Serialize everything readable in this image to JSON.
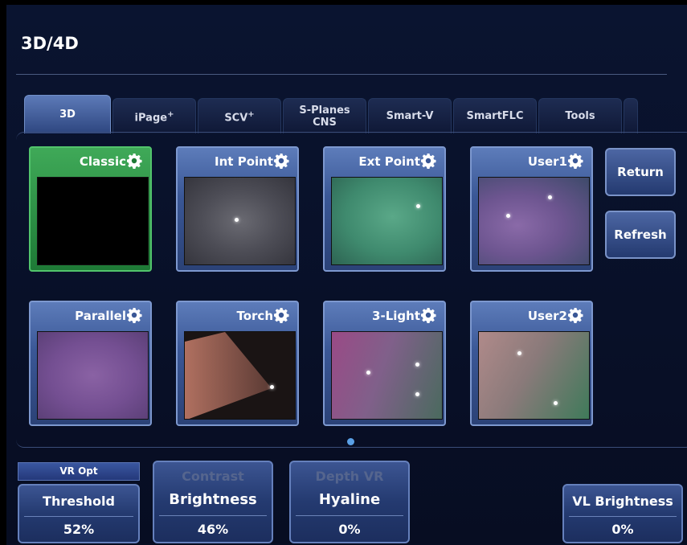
{
  "header": {
    "title": "3D/4D"
  },
  "tabs": [
    {
      "label": "3D",
      "sup": "",
      "active": true
    },
    {
      "label": "iPage",
      "sup": "+",
      "active": false
    },
    {
      "label": "SCV",
      "sup": "+",
      "active": false
    },
    {
      "label": "S-Planes\nCNS",
      "sup": "",
      "active": false
    },
    {
      "label": "Smart-V",
      "sup": "",
      "active": false
    },
    {
      "label": "SmartFLC",
      "sup": "",
      "active": false
    },
    {
      "label": "Tools",
      "sup": "",
      "active": false
    }
  ],
  "presets": [
    {
      "label": "Classic",
      "selected": true
    },
    {
      "label": "Int Point",
      "selected": false
    },
    {
      "label": "Ext Point",
      "selected": false
    },
    {
      "label": "User1",
      "selected": false
    },
    {
      "label": "Parallel",
      "selected": false
    },
    {
      "label": "Torch",
      "selected": false
    },
    {
      "label": "3-Light",
      "selected": false
    },
    {
      "label": "User2",
      "selected": false
    }
  ],
  "side_buttons": {
    "return_label": "Return",
    "refresh_label": "Refresh"
  },
  "controls": {
    "vr_opt_label": "VR Opt",
    "threshold": {
      "label": "Threshold",
      "value": "52%"
    },
    "contrast_brightness": {
      "top": "Contrast",
      "label": "Brightness",
      "value": "46%"
    },
    "depth_hyaline": {
      "top": "Depth VR",
      "label": "Hyaline",
      "value": "0%"
    },
    "vl_brightness": {
      "label": "VL Brightness",
      "value": "0%"
    }
  },
  "pager": {
    "current_page": 1
  },
  "colors": {
    "selected": "#2f9a4a",
    "accent": "#5aa0e6",
    "tab_active": "#5c7ab8"
  },
  "icons": {
    "preset_settings": "gear-icon"
  }
}
